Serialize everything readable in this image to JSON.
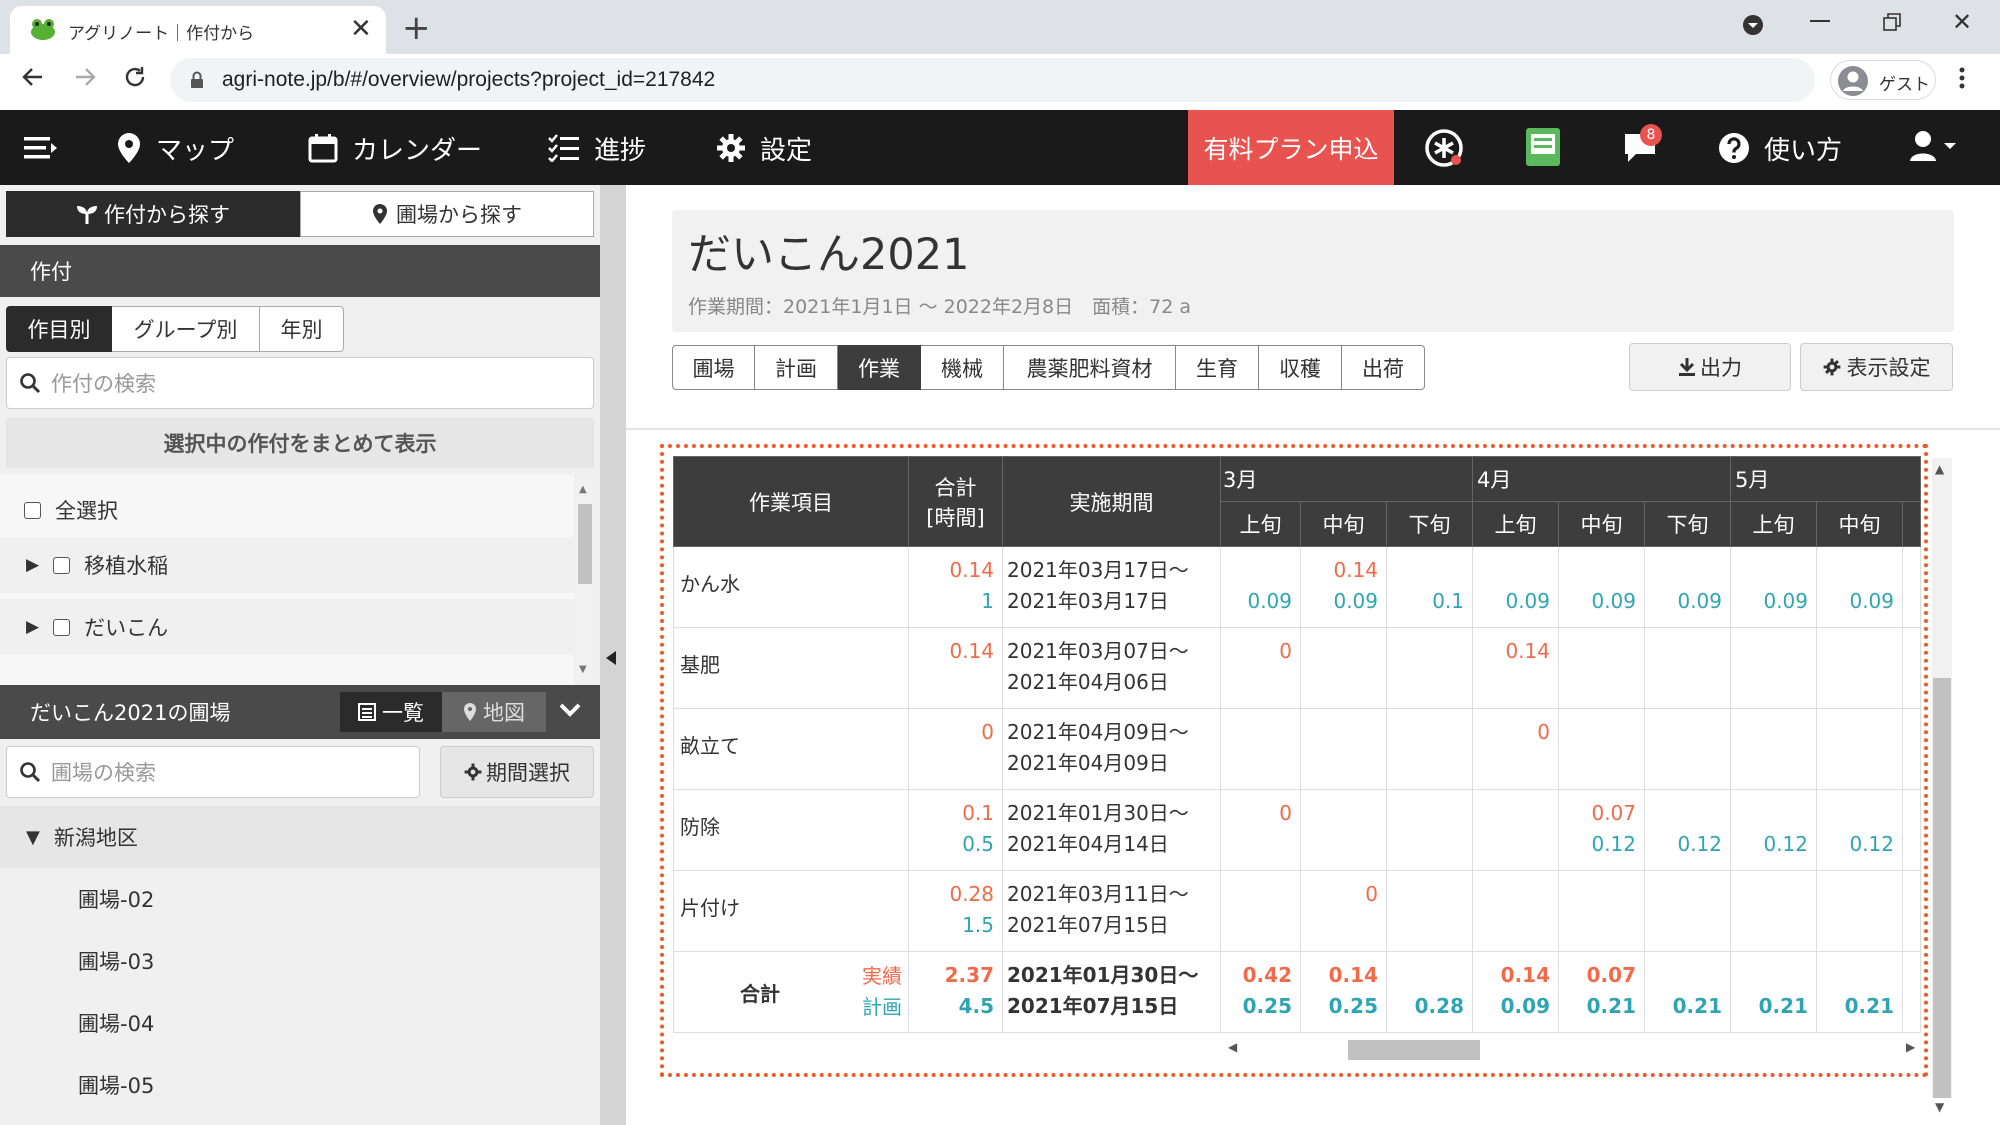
{
  "browser": {
    "tab_title": "アグリノート｜作付から",
    "url": "agri-note.jp/b/#/overview/projects?project_id=217842",
    "profile_label": "ゲスト"
  },
  "nav": {
    "map": "マップ",
    "calendar": "カレンダー",
    "progress": "進捗",
    "settings": "設定",
    "paid_plan": "有料プラン申込",
    "notification_count": "8",
    "help": "使い方"
  },
  "left": {
    "tab_crop": "作付から探す",
    "tab_field": "圃場から探す",
    "section_title": "作付",
    "filter_tabs": [
      "作目別",
      "グループ別",
      "年別"
    ],
    "search_placeholder": "作付の検索",
    "show_selected": "選択中の作付をまとめて表示",
    "select_all": "全選択",
    "crops": [
      "移植水稲",
      "だいこん"
    ],
    "fields_title": "だいこん2021の圃場",
    "view_list": "一覧",
    "view_map": "地図",
    "field_search_placeholder": "圃場の検索",
    "period_select": "期間選択",
    "region": "新潟地区",
    "fields": [
      "圃場-02",
      "圃場-03",
      "圃場-04",
      "圃場-05"
    ]
  },
  "project": {
    "title": "だいこん2021",
    "subtitle": "作業期間：2021年1月1日 ～ 2022年2月8日　面積：72 a",
    "tabs": [
      "圃場",
      "計画",
      "作業",
      "機械",
      "農薬肥料資材",
      "生育",
      "収穫",
      "出荷"
    ],
    "export": "出力",
    "display_settings": "表示設定"
  },
  "table": {
    "h_item": "作業項目",
    "h_total_1": "合計",
    "h_total_2": "[時間]",
    "h_period": "実施期間",
    "months": [
      "3月",
      "4月",
      "5月"
    ],
    "decades": [
      "上旬",
      "中旬",
      "下旬",
      "上旬",
      "中旬",
      "下旬",
      "上旬",
      "中旬"
    ],
    "rows": [
      {
        "name": "かん水",
        "t1": "0.14",
        "t2": "1",
        "p1": "2021年03月17日～",
        "p2": "2021年03月17日",
        "c1": [
          "",
          "0.14",
          "",
          "",
          "",
          "",
          "",
          ""
        ],
        "c2": [
          "0.09",
          "0.09",
          "0.1",
          "0.09",
          "0.09",
          "0.09",
          "0.09",
          "0.09"
        ]
      },
      {
        "name": "基肥",
        "t1": "0.14",
        "t2": "",
        "p1": "2021年03月07日～",
        "p2": "2021年04月06日",
        "c1": [
          "0",
          "",
          "",
          "0.14",
          "",
          "",
          "",
          ""
        ],
        "c2": [
          "",
          "",
          "",
          "",
          "",
          "",
          "",
          ""
        ]
      },
      {
        "name": "畝立て",
        "t1": "0",
        "t2": "",
        "p1": "2021年04月09日～",
        "p2": "2021年04月09日",
        "c1": [
          "",
          "",
          "",
          "0",
          "",
          "",
          "",
          ""
        ],
        "c2": [
          "",
          "",
          "",
          "",
          "",
          "",
          "",
          ""
        ]
      },
      {
        "name": "防除",
        "t1": "0.1",
        "t2": "0.5",
        "p1": "2021年01月30日～",
        "p2": "2021年04月14日",
        "c1": [
          "0",
          "",
          "",
          "",
          "0.07",
          "",
          "",
          ""
        ],
        "c2": [
          "",
          "",
          "",
          "",
          "0.12",
          "0.12",
          "0.12",
          "0.12"
        ]
      },
      {
        "name": "片付け",
        "t1": "0.28",
        "t2": "1.5",
        "p1": "2021年03月11日～",
        "p2": "2021年07月15日",
        "c1": [
          "",
          "0",
          "",
          "",
          "",
          "",
          "",
          ""
        ],
        "c2": [
          "",
          "",
          "",
          "",
          "",
          "",
          "",
          ""
        ]
      }
    ],
    "total": {
      "label": "合計",
      "actual": "実績",
      "plan": "計画",
      "t1": "2.37",
      "t2": "4.5",
      "p1": "2021年01月30日～",
      "p2": "2021年07月15日",
      "c1": [
        "0.42",
        "0.14",
        "",
        "0.14",
        "0.07",
        "",
        "",
        ""
      ],
      "c2": [
        "0.25",
        "0.25",
        "0.28",
        "0.09",
        "0.21",
        "0.21",
        "0.21",
        "0.21"
      ]
    }
  }
}
